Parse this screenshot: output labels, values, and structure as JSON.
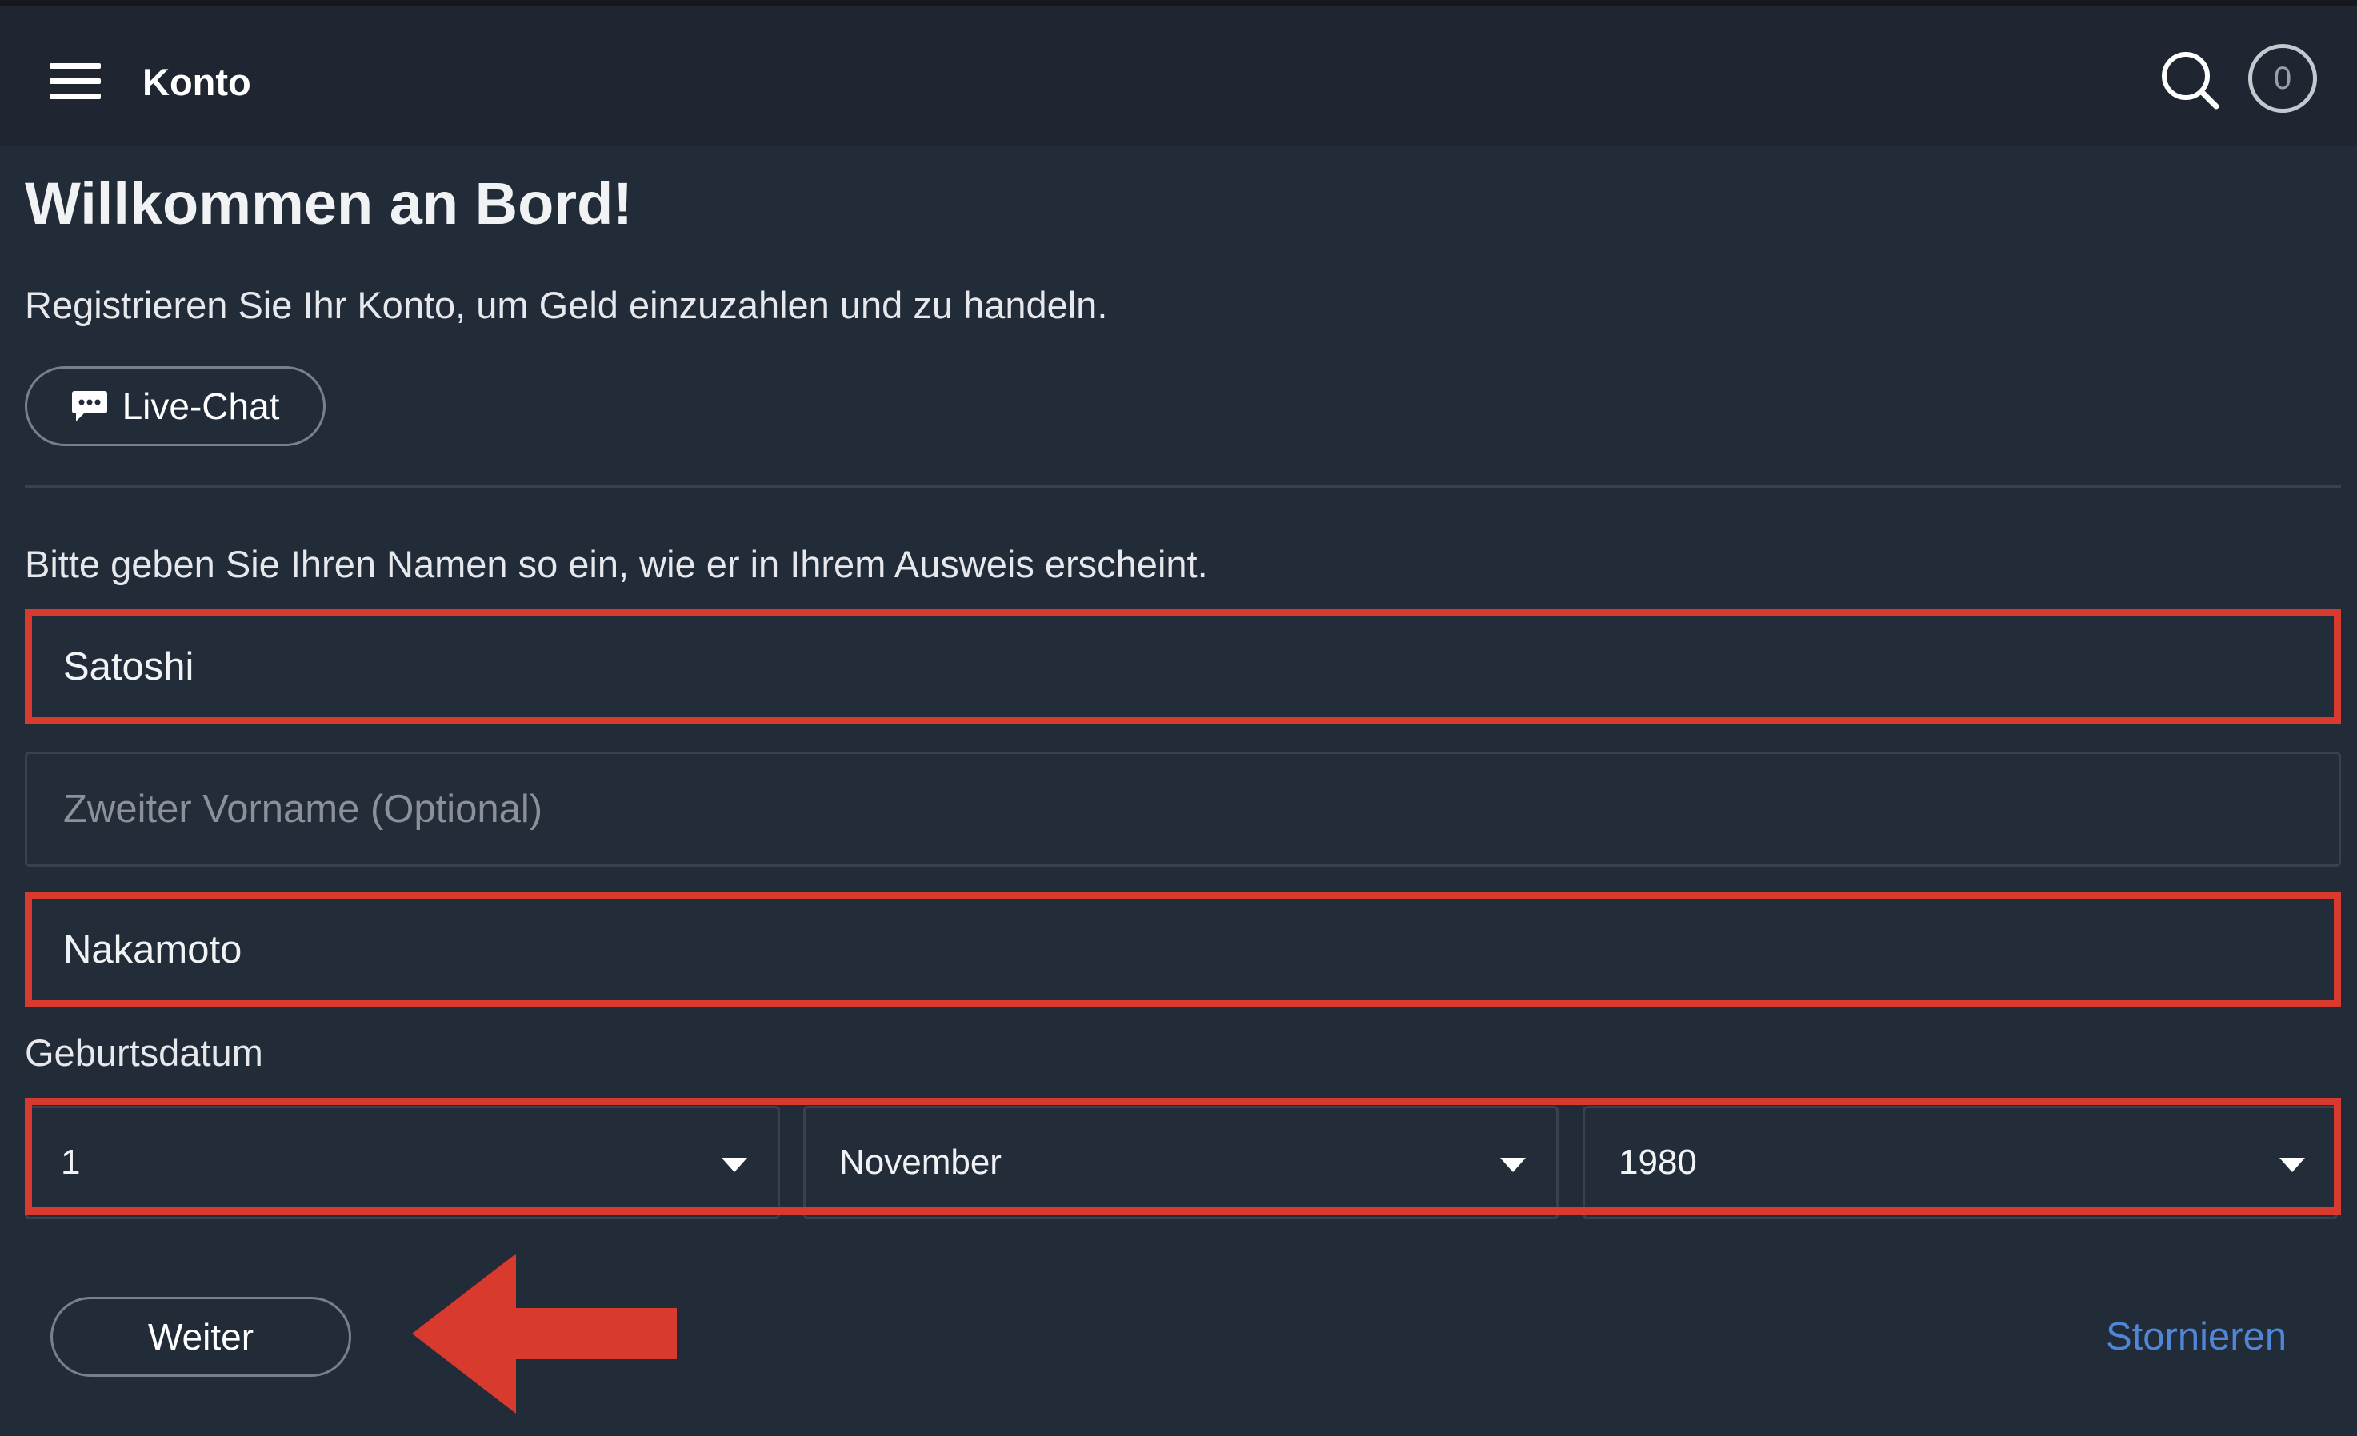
{
  "header": {
    "menu_icon": "hamburger-menu-icon",
    "title": "Konto",
    "search_icon": "search-icon",
    "badge_count": "0"
  },
  "main": {
    "heading": "Willkommen an Bord!",
    "subtitle": "Registrieren Sie Ihr Konto, um Geld einzuzahlen und zu handeln.",
    "live_chat": {
      "icon": "chat-bubble-icon",
      "label": "Live-Chat"
    },
    "name_instruction": "Bitte geben Sie Ihren Namen so ein, wie er in Ihrem Ausweis erscheint.",
    "first_name": {
      "value": "Satoshi",
      "placeholder": ""
    },
    "middle_name": {
      "value": "",
      "placeholder": "Zweiter Vorname (Optional)"
    },
    "last_name": {
      "value": "Nakamoto",
      "placeholder": ""
    },
    "dob_label": "Geburtsdatum",
    "dob": {
      "day": "1",
      "month": "November",
      "year": "1980"
    },
    "next_label": "Weiter",
    "cancel_label": "Stornieren"
  },
  "annotations": {
    "highlight_color": "#d83a2e",
    "arrow_color": "#d83a2e",
    "arrow_target": "Weiter"
  },
  "colors": {
    "background": "#222b38",
    "header_background": "#1f2631",
    "link": "#4f86d6"
  }
}
